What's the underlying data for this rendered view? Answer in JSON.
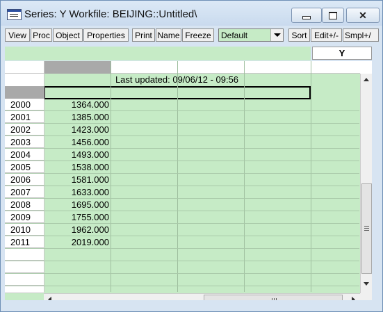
{
  "window": {
    "title": "Series: Y   Workfile: BEIJING::Untitled\\"
  },
  "toolbar": {
    "buttons": [
      "View",
      "Proc",
      "Object",
      "Properties",
      "Print",
      "Name",
      "Freeze",
      "Sort",
      "Edit+/-",
      "Smpl+/"
    ],
    "sample_dropdown": "Default"
  },
  "series_header": "Y",
  "sheet": {
    "last_updated": "Last updated: 09/06/12 - 09:56",
    "rows": [
      {
        "obs": "2000",
        "value": "1364.000"
      },
      {
        "obs": "2001",
        "value": "1385.000"
      },
      {
        "obs": "2002",
        "value": "1423.000"
      },
      {
        "obs": "2003",
        "value": "1456.000"
      },
      {
        "obs": "2004",
        "value": "1493.000"
      },
      {
        "obs": "2005",
        "value": "1538.000"
      },
      {
        "obs": "2006",
        "value": "1581.000"
      },
      {
        "obs": "2007",
        "value": "1633.000"
      },
      {
        "obs": "2008",
        "value": "1695.000"
      },
      {
        "obs": "2009",
        "value": "1755.000"
      },
      {
        "obs": "2010",
        "value": "1962.000"
      },
      {
        "obs": "2011",
        "value": "2019.000"
      }
    ]
  }
}
